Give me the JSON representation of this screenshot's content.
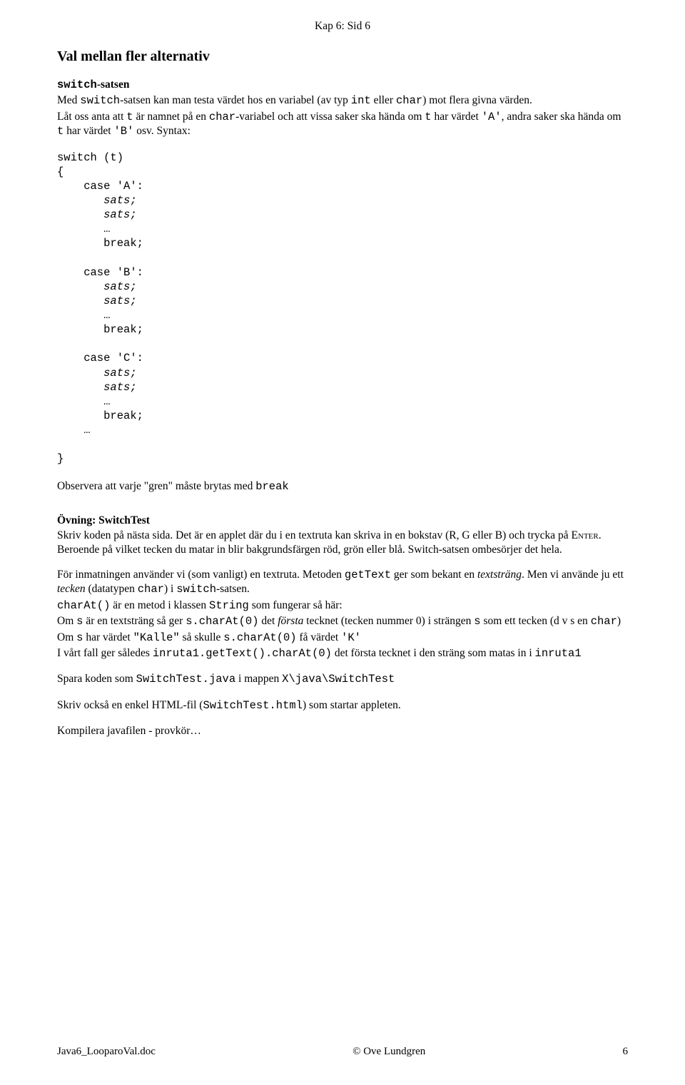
{
  "header": {
    "chapter": "Kap 6:  Sid 6"
  },
  "section_title": "Val mellan fler alternativ",
  "switch_satsen": {
    "heading_mono": "switch",
    "heading_suffix": "-satsen",
    "p1_a": "Med ",
    "p1_b": "switch",
    "p1_c": "-satsen kan man testa värdet hos en variabel (av typ ",
    "p1_d": "int",
    "p1_e": " eller ",
    "p1_f": "char",
    "p1_g": ") mot flera givna värden.",
    "p2_a": "Låt oss anta att ",
    "p2_b": "t",
    "p2_c": " är namnet på en ",
    "p2_d": "char",
    "p2_e": "-variabel och att vissa saker ska hända om  ",
    "p2_f": "t",
    "p2_g": "  har värdet ",
    "p2_h": "'A'",
    "p2_i": ", andra saker ska hända om  ",
    "p2_j": "t",
    "p2_k": "  har värdet ",
    "p2_l": "'B'",
    "p2_m": " osv.    Syntax:"
  },
  "code": {
    "l01": "switch (t)",
    "l02": "{",
    "l03": "    case 'A':",
    "l04": "       sats;",
    "l05": "       sats;",
    "l06": "       …",
    "l07": "       break;",
    "l08": "",
    "l09": "    case 'B':",
    "l10": "       sats;",
    "l11": "       sats;",
    "l12": "       …",
    "l13": "       break;",
    "l14": "",
    "l15": "    case 'C':",
    "l16": "       sats;",
    "l17": "       sats;",
    "l18": "       …",
    "l19": "       break;",
    "l20": "    …",
    "l21": "",
    "l22": "}"
  },
  "obs": {
    "a": "Observera att varje \"gren\" måste brytas med ",
    "b": "break"
  },
  "exercise": {
    "title": "Övning: SwitchTest",
    "p1_a": "Skriv koden på nästa sida. Det är en applet där du i en textruta kan skriva in en bokstav (R, G eller B) och trycka på ",
    "p1_enter": "Enter",
    "p1_b": ". Beroende på vilket tecken du matar in blir bakgrundsfärgen röd, grön eller blå. Switch-satsen ombesörjer det hela.",
    "p2_a": "För inmatningen använder vi (som vanligt) en textruta. Metoden ",
    "p2_b": "getText",
    "p2_c": " ger som bekant en ",
    "p2_d": "textsträng",
    "p2_e": ". Men vi använde ju ett ",
    "p2_f": "tecken",
    "p2_g": " (datatypen ",
    "p2_h": "char",
    "p2_i": ") i ",
    "p2_j": "switch",
    "p2_k": "-satsen.",
    "p3_a": "charAt()",
    "p3_b": " är en metod i klassen ",
    "p3_c": "String",
    "p3_d": " som fungerar så här:",
    "p4_a": "Om ",
    "p4_b": "s",
    "p4_c": " är en textsträng så ger  ",
    "p4_d": "s.charAt(0)",
    "p4_e": "  det  ",
    "p4_f": "första",
    "p4_g": " tecknet (tecken nummer 0) i strängen ",
    "p4_h": "s",
    "p4_i": " som ett tecken  (d v s en ",
    "p4_j": "char",
    "p4_k": ")",
    "p5_a": "Om ",
    "p5_b": "s",
    "p5_c": " har värdet ",
    "p5_d": "\"Kalle\"",
    "p5_e": " så skulle  ",
    "p5_f": "s.charAt(0)",
    "p5_g": "  få värdet ",
    "p5_h": "'K'",
    "p6_a": "I vårt fall ger således ",
    "p6_b": "inruta1.getText().charAt(0)",
    "p6_c": " det första tecknet i den sträng som matas in i ",
    "p6_d": "inruta1",
    "save_a": "Spara koden som ",
    "save_b": "SwitchTest.java",
    "save_c": " i mappen ",
    "save_d": "X\\java\\SwitchTest",
    "html_a": "Skriv också en enkel HTML-fil  (",
    "html_b": "SwitchTest.html",
    "html_c": ")  som startar appleten.",
    "compile": "Kompilera javafilen  - provkör…"
  },
  "footer": {
    "left": "Java6_LooparoVal.doc",
    "center": "© Ove Lundgren",
    "right": "6"
  }
}
